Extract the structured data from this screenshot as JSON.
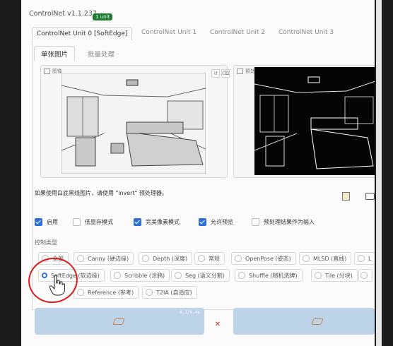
{
  "header": {
    "title": "ControlNet v1.1.237",
    "badge": "1 unit"
  },
  "unit_tabs": [
    {
      "label": "ControlNet Unit 0 [SoftEdge]",
      "active": true
    },
    {
      "label": "ControlNet Unit 1"
    },
    {
      "label": "ControlNet Unit 2"
    },
    {
      "label": "ControlNet Unit 3"
    }
  ],
  "subtabs": [
    {
      "label": "单张图片",
      "active": true
    },
    {
      "label": "批量处理"
    }
  ],
  "image_panel": {
    "label": "图像"
  },
  "preview_panel": {
    "label": "预处理结果预览"
  },
  "note": "如果使用白底黑线图片，请使用 \"invert\" 预处理器。",
  "checkboxes": [
    {
      "label": "启用",
      "checked": true
    },
    {
      "label": "低显存模式",
      "checked": false
    },
    {
      "label": "完美像素模式",
      "checked": true
    },
    {
      "label": "允许预览",
      "checked": true
    },
    {
      "label": "预处理结果作为输入",
      "checked": false
    }
  ],
  "control_type": {
    "label": "控制类型",
    "row1": [
      "全部",
      "Canny (硬边缘)",
      "Depth (深度)",
      "常规",
      "OpenPose (姿态)",
      "MLSD (直线)",
      "L"
    ],
    "row2": [
      "SoftEdge (软边缘)",
      "Scribble (涂鸦)",
      "Seg (语义分割)",
      "Shuffle (随机洗牌)",
      "Tile (分块)"
    ],
    "row3": [
      "Reference (参考)",
      "T2IA (自适应)"
    ],
    "selected": "SoftEdge (软边缘)"
  },
  "dropzone_readout": "0.1/0.4s",
  "colors": {
    "accent": "#2f6fd8",
    "badge": "#1e7d33",
    "dropzone": "#bcd3e8",
    "annotation": "#d81b1b"
  }
}
